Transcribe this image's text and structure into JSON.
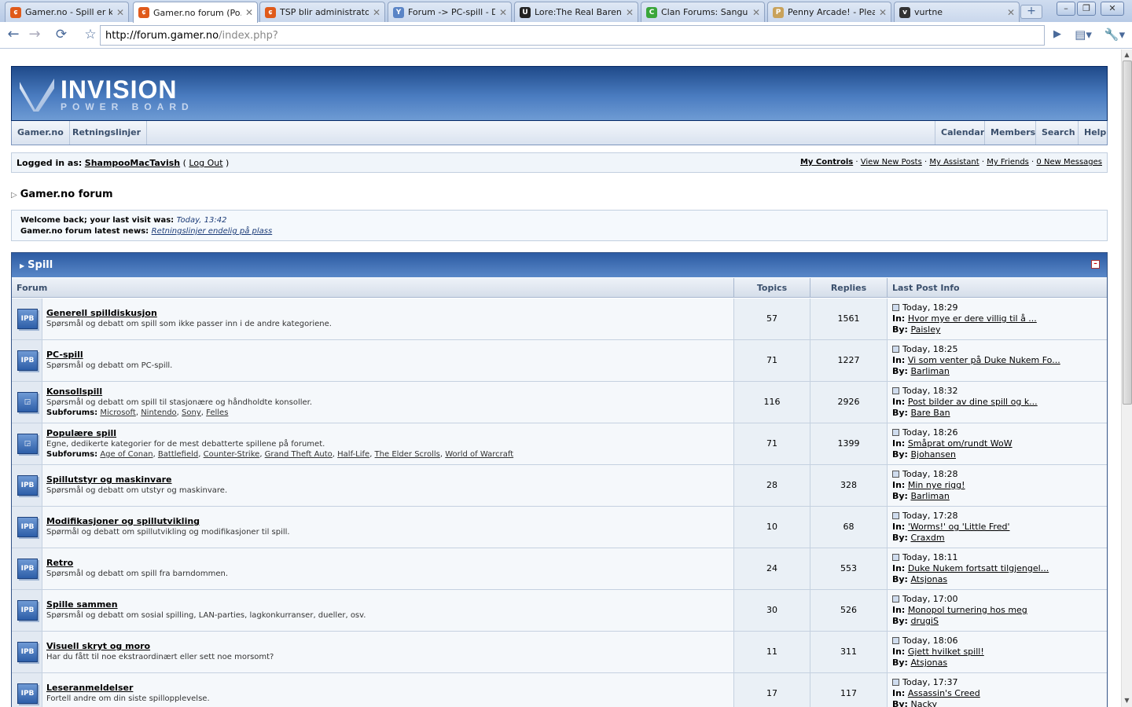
{
  "browser": {
    "tabs": [
      {
        "title": "Gamer.no - Spill er ku...",
        "favicon": "gamer-favicon",
        "color": "#e05a1a",
        "glyph": "ɕ"
      },
      {
        "title": "Gamer.no forum (Po...",
        "favicon": "gamer-favicon",
        "color": "#e05a1a",
        "glyph": "ɕ",
        "active": true
      },
      {
        "title": "TSP blir administrator...",
        "favicon": "gamer-favicon",
        "color": "#e05a1a",
        "glyph": "ɕ"
      },
      {
        "title": "Forum -> PC-spill - Di...",
        "favicon": "forum-favicon",
        "color": "#5a84c6",
        "glyph": "Y"
      },
      {
        "title": "Lore:The Real Baren...",
        "favicon": "uesp-favicon",
        "color": "#222222",
        "glyph": "U"
      },
      {
        "title": "Clan Forums: Sangui...",
        "favicon": "clan-favicon",
        "color": "#3aa63a",
        "glyph": "C"
      },
      {
        "title": "Penny Arcade! - Plea...",
        "favicon": "pa-favicon",
        "color": "#c9a25a",
        "glyph": "P"
      },
      {
        "title": "vurtne",
        "favicon": "vurtne-favicon",
        "color": "#333333",
        "glyph": "v"
      }
    ],
    "url_host": "http://forum.gamer.no",
    "url_path": "/index.php?"
  },
  "header": {
    "logo_word": "INVISION",
    "logo_sub": "POWER BOARD"
  },
  "submenu": {
    "left": [
      "Gamer.no",
      "Retningslinjer"
    ],
    "right": [
      "Calendar",
      "Members",
      "Search",
      "Help"
    ]
  },
  "userbar": {
    "logged_in_label": "Logged in as:",
    "username": "ShampooMacTavish",
    "logout": "Log Out",
    "links": [
      "My Controls",
      "View New Posts",
      "My Assistant",
      "My Friends",
      "0 New Messages"
    ]
  },
  "navstrip": "Gamer.no forum",
  "welcome": {
    "last_visit_label": "Welcome back; your last visit was:",
    "last_visit": "Today, 13:42",
    "news_label": "Gamer.no forum latest news:",
    "news_link": "Retningslinjer endelig på plass"
  },
  "category": {
    "title": "Spill",
    "columns": {
      "forum": "Forum",
      "topics": "Topics",
      "replies": "Replies",
      "last": "Last Post Info"
    },
    "in_label": "In:",
    "by_label": "By:",
    "subforums_label": "Subforums:",
    "forums": [
      {
        "name": "Generell spilldiskusjon",
        "desc": "Spørsmål og debatt om spill som ikke passer inn i de andre kategoriene.",
        "topics": "57",
        "replies": "1561",
        "time": "Today, 18:29",
        "in": "Hvor mye er dere villig til å ...",
        "by": "Paisley",
        "icon": "IPB"
      },
      {
        "name": "PC-spill",
        "desc": "Spørsmål og debatt om PC-spill.",
        "topics": "71",
        "replies": "1227",
        "time": "Today, 18:25",
        "in": "Vi som venter på Duke Nukem Fo...",
        "by": "Barliman",
        "icon": "IPB"
      },
      {
        "name": "Konsollspill",
        "desc": "Spørsmål og debatt om spill til stasjonære og håndholdte konsoller.",
        "subforums": [
          "Microsoft",
          "Nintendo",
          "Sony",
          "Felles"
        ],
        "topics": "116",
        "replies": "2926",
        "time": "Today, 18:32",
        "in": "Post bilder av dine spill og k...",
        "by": "Bare Ban",
        "icon": "◲"
      },
      {
        "name": "Populære spill",
        "desc": "Egne, dedikerte kategorier for de mest debatterte spillene på forumet.",
        "subforums": [
          "Age of Conan",
          "Battlefield",
          "Counter-Strike",
          "Grand Theft Auto",
          "Half-Life",
          "The Elder Scrolls",
          "World of Warcraft"
        ],
        "topics": "71",
        "replies": "1399",
        "time": "Today, 18:26",
        "in": "Småprat om/rundt WoW",
        "by": "Bjohansen",
        "icon": "◲"
      },
      {
        "name": "Spillutstyr og maskinvare",
        "desc": "Spørsmål og debatt om utstyr og maskinvare.",
        "topics": "28",
        "replies": "328",
        "time": "Today, 18:28",
        "in": "Min nye rigg!",
        "by": "Barliman",
        "icon": "IPB"
      },
      {
        "name": "Modifikasjoner og spillutvikling",
        "desc": "Spørmål og debatt om spillutvikling og modifikasjoner til spill.",
        "topics": "10",
        "replies": "68",
        "time": "Today, 17:28",
        "in": "'Worms!' og 'Little Fred'",
        "by": "Craxdm",
        "icon": "IPB"
      },
      {
        "name": "Retro",
        "desc": "Spørsmål og debatt om spill fra barndommen.",
        "topics": "24",
        "replies": "553",
        "time": "Today, 18:11",
        "in": "Duke Nukem fortsatt tilgjengel...",
        "by": "Atsjonas",
        "icon": "IPB"
      },
      {
        "name": "Spille sammen",
        "desc": "Spørsmål og debatt om sosial spilling, LAN-parties, lagkonkurranser, dueller, osv.",
        "topics": "30",
        "replies": "526",
        "time": "Today, 17:00",
        "in": "Monopol turnering hos meg",
        "by": "drugiS",
        "icon": "IPB"
      },
      {
        "name": "Visuell skryt og moro",
        "desc": "Har du fått til noe ekstraordinært eller sett noe morsomt?",
        "topics": "11",
        "replies": "311",
        "time": "Today, 18:06",
        "in": "Gjett hvilket spill!",
        "by": "Atsjonas",
        "icon": "IPB"
      },
      {
        "name": "Leseranmeldelser",
        "desc": "Fortell andre om din siste spillopplevelse.",
        "topics": "17",
        "replies": "117",
        "time": "Today, 17:37",
        "in": "Assassin's Creed",
        "by": "Nacky",
        "icon": "IPB"
      }
    ]
  }
}
